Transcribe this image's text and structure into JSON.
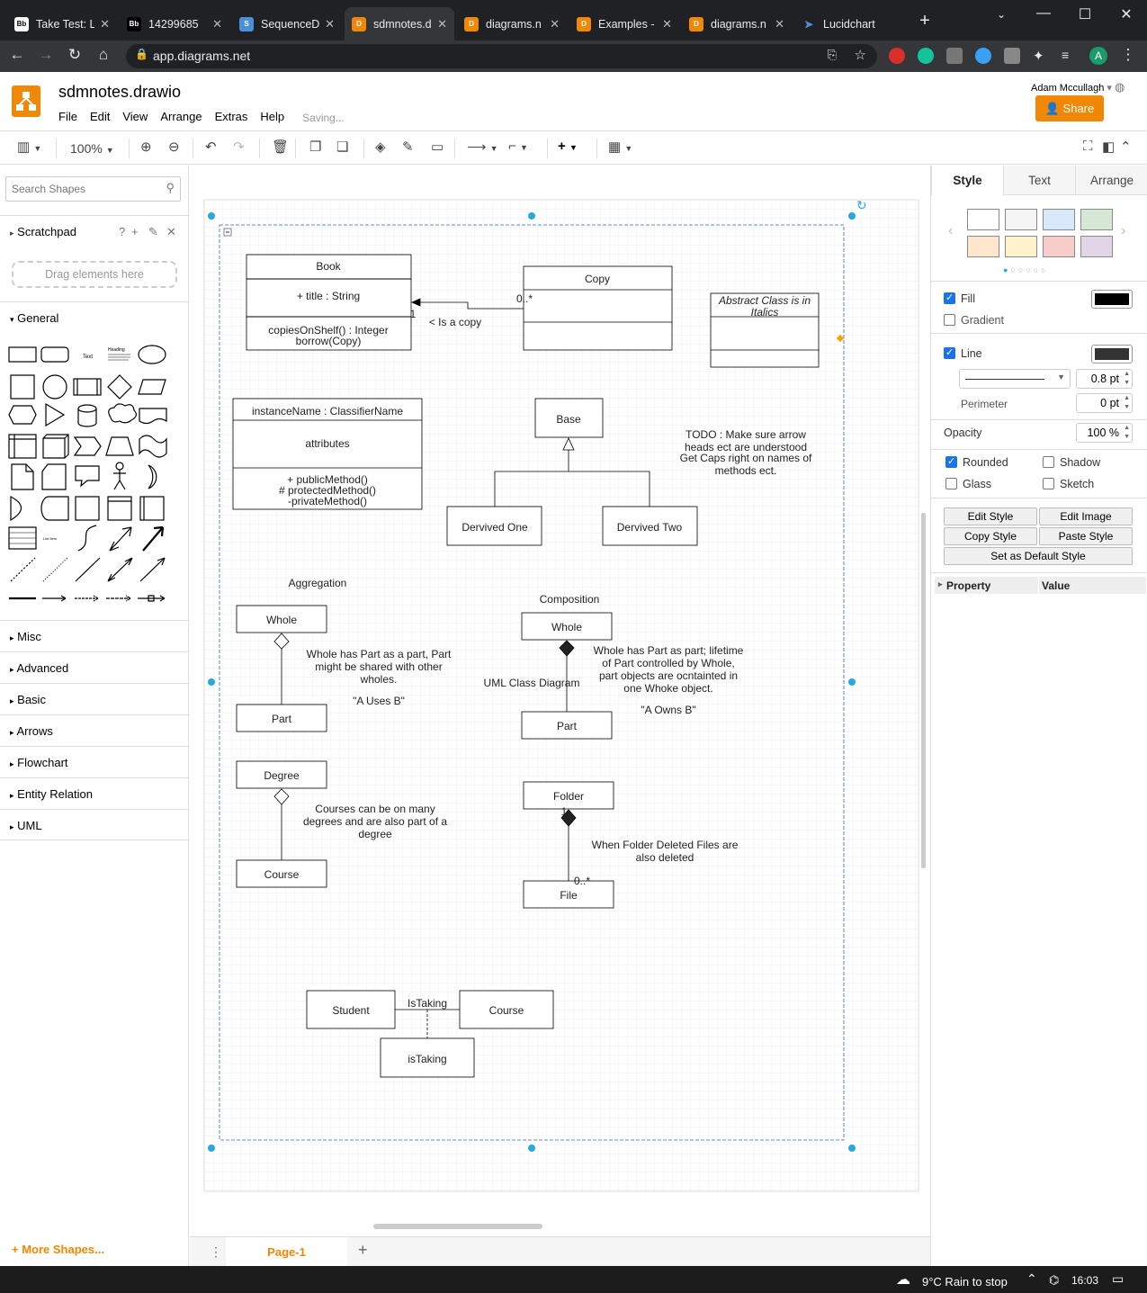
{
  "browser": {
    "tabs": [
      {
        "title": "Take Test: L",
        "icon": "Bb"
      },
      {
        "title": "14299685",
        "icon": "Bb"
      },
      {
        "title": "SequenceD",
        "icon": "S"
      },
      {
        "title": "sdmnotes.d",
        "icon": "D"
      },
      {
        "title": "diagrams.n",
        "icon": "D"
      },
      {
        "title": "Examples -",
        "icon": "D"
      },
      {
        "title": "diagrams.n",
        "icon": "D"
      },
      {
        "title": "Lucidchart",
        "icon": "L"
      }
    ],
    "url": "app.diagrams.net",
    "profile_letter": "A"
  },
  "app": {
    "doc_title": "sdmnotes.drawio",
    "menu": [
      "File",
      "Edit",
      "View",
      "Arrange",
      "Extras",
      "Help"
    ],
    "saving": "Saving...",
    "user": "Adam Mccullagh",
    "share": "Share",
    "zoom": "100%"
  },
  "left": {
    "search_placeholder": "Search Shapes",
    "scratchpad": "Scratchpad",
    "scratch_help": "?",
    "drag_here": "Drag elements here",
    "general": "General",
    "sections": [
      "Misc",
      "Advanced",
      "Basic",
      "Arrows",
      "Flowchart",
      "Entity Relation",
      "UML"
    ],
    "more_shapes": "+ More Shapes...",
    "text_shape": "Text",
    "heading_shape": "Heading",
    "list_item_shape": "List Item"
  },
  "right": {
    "tabs": [
      "Style",
      "Text",
      "Arrange"
    ],
    "fill": "Fill",
    "gradient": "Gradient",
    "line": "Line",
    "line_width": "0.8 pt",
    "perimeter": "Perimeter",
    "perimeter_value": "0 pt",
    "opacity": "Opacity",
    "opacity_value": "100 %",
    "rounded": "Rounded",
    "shadow": "Shadow",
    "glass": "Glass",
    "sketch": "Sketch",
    "edit_style": "Edit Style",
    "edit_image": "Edit Image",
    "copy_style": "Copy Style",
    "paste_style": "Paste Style",
    "set_default": "Set as Default Style",
    "property": "Property",
    "value": "Value",
    "swatches": [
      "#ffffff",
      "#f5f5f5",
      "#dae8fc",
      "#d5e8d4",
      "#ffe6cc",
      "#fff2cc",
      "#f8cecc",
      "#e1d5e7"
    ],
    "fill_color": "#000000",
    "line_color": "#333333"
  },
  "diagram": {
    "book": {
      "name": "Book",
      "attr": "+ title : String",
      "m1": "copiesOnShelf() : Integer",
      "m2": "borrow(Copy)"
    },
    "copy": {
      "name": "Copy"
    },
    "copy_mult": "0..*",
    "book_mult": "1",
    "is_a_copy": "< Is a copy",
    "abstract": {
      "l1": "Abstract Class is in",
      "l2": "Italics"
    },
    "instance": {
      "name": "instanceName : ClassifierName",
      "attr": "attributes",
      "m1": "+ publicMethod()",
      "m2": "# protectedMethod()",
      "m3": "-privateMethod()"
    },
    "base": "Base",
    "derived_one": "Dervived One",
    "derived_two": "Dervived Two",
    "todo": [
      "TODO : Make sure arrow",
      "heads ect are understood",
      "Get Caps right on names of",
      "methods ect."
    ],
    "aggregation": "Aggregation",
    "agg_whole": "Whole",
    "agg_part": "Part",
    "agg_note": [
      "Whole has Part as a part, Part",
      "might be shared with other",
      "wholes."
    ],
    "agg_uses": "\"A Uses B\"",
    "composition": "Composition",
    "comp_whole": "Whole",
    "comp_part": "Part",
    "comp_note": [
      "Whole has Part as part; lifetime",
      "of Part controlled by Whole,",
      "part objects are ocntainted in",
      "one Whoke object."
    ],
    "comp_owns": "\"A Owns B\"",
    "uml_class_diagram": "UML Class Diagram",
    "degree": "Degree",
    "course1": "Course",
    "degree_note": [
      "Courses can be on many",
      "degrees and are also part of a",
      "degree"
    ],
    "folder": "Folder",
    "file": "File",
    "folder_mult": "1",
    "file_mult": "0..*",
    "folder_note": [
      "When Folder Deleted Files are",
      "also deleted"
    ],
    "student": "Student",
    "course2": "Course",
    "is_taking_label": "IsTaking",
    "is_taking_class": "isTaking"
  },
  "pages": {
    "current": "Page-1"
  },
  "taskbar": {
    "weather": "9°C  Rain to stop",
    "time": "16:03"
  }
}
